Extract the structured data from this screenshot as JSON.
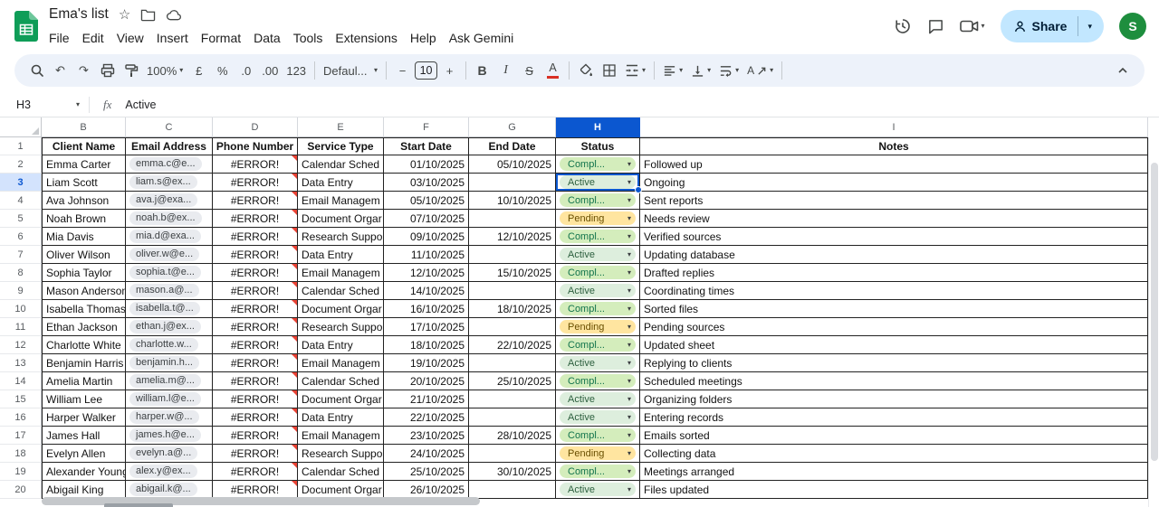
{
  "topbar": {
    "title": "Ema's list",
    "menus": [
      "File",
      "Edit",
      "View",
      "Insert",
      "Format",
      "Data",
      "Tools",
      "Extensions",
      "Help",
      "Ask Gemini"
    ],
    "share_label": "Share",
    "avatar_letter": "S"
  },
  "icons": {
    "star": "☆",
    "undo": "↶",
    "redo": "↷",
    "currency": "£",
    "percent": "%",
    "decrease_decimal": ".0",
    "increase_decimal": ".00",
    "number_format": "123",
    "minus": "−",
    "plus": "+",
    "bold": "B",
    "italic": "I",
    "strikethrough": "S",
    "text_color_letter": "A",
    "rotate_letter": "A",
    "more_vert": "⋮",
    "caret_down": "▾"
  },
  "toolbar": {
    "zoom": "100%",
    "font_name": "Defaul...",
    "font_size": "10"
  },
  "formula_bar": {
    "cell_ref": "H3",
    "fx_label": "fx",
    "value": "Active"
  },
  "grid": {
    "column_letters": [
      "B",
      "C",
      "D",
      "E",
      "F",
      "G",
      "H",
      "I"
    ],
    "selected_column": "H",
    "selected_row": 3,
    "selected_cell": "H3",
    "header_row": [
      "Client Name",
      "Email Address",
      "Phone Number",
      "Service Type",
      "Start Date",
      "End Date",
      "Status",
      "Notes"
    ],
    "rows": [
      {
        "n": 2,
        "client": "Emma Carter",
        "email": "emma.c@e...",
        "phone": "#ERROR!",
        "service": "Calendar Sched",
        "start": "01/10/2025",
        "end": "05/10/2025",
        "status": "Compl...",
        "status_type": "completed",
        "notes": "Followed up"
      },
      {
        "n": 3,
        "client": "Liam Scott",
        "email": "liam.s@ex...",
        "phone": "#ERROR!",
        "service": "Data Entry",
        "start": "03/10/2025",
        "end": "",
        "status": "Active",
        "status_type": "active",
        "notes": "Ongoing"
      },
      {
        "n": 4,
        "client": "Ava Johnson",
        "email": "ava.j@exa...",
        "phone": "#ERROR!",
        "service": "Email Managem",
        "start": "05/10/2025",
        "end": "10/10/2025",
        "status": "Compl...",
        "status_type": "completed",
        "notes": "Sent reports"
      },
      {
        "n": 5,
        "client": "Noah Brown",
        "email": "noah.b@ex...",
        "phone": "#ERROR!",
        "service": "Document Orgar",
        "start": "07/10/2025",
        "end": "",
        "status": "Pending",
        "status_type": "pending",
        "notes": "Needs review"
      },
      {
        "n": 6,
        "client": "Mia Davis",
        "email": "mia.d@exa...",
        "phone": "#ERROR!",
        "service": "Research Suppo",
        "start": "09/10/2025",
        "end": "12/10/2025",
        "status": "Compl...",
        "status_type": "completed",
        "notes": "Verified sources"
      },
      {
        "n": 7,
        "client": "Oliver Wilson",
        "email": "oliver.w@e...",
        "phone": "#ERROR!",
        "service": "Data Entry",
        "start": "11/10/2025",
        "end": "",
        "status": "Active",
        "status_type": "active",
        "notes": "Updating database"
      },
      {
        "n": 8,
        "client": "Sophia Taylor",
        "email": "sophia.t@e...",
        "phone": "#ERROR!",
        "service": "Email Managem",
        "start": "12/10/2025",
        "end": "15/10/2025",
        "status": "Compl...",
        "status_type": "completed",
        "notes": "Drafted replies"
      },
      {
        "n": 9,
        "client": "Mason Anderson",
        "email": "mason.a@...",
        "phone": "#ERROR!",
        "service": "Calendar Sched",
        "start": "14/10/2025",
        "end": "",
        "status": "Active",
        "status_type": "active",
        "notes": "Coordinating times"
      },
      {
        "n": 10,
        "client": "Isabella Thomas",
        "email": "isabella.t@...",
        "phone": "#ERROR!",
        "service": "Document Orgar",
        "start": "16/10/2025",
        "end": "18/10/2025",
        "status": "Compl...",
        "status_type": "completed",
        "notes": "Sorted files"
      },
      {
        "n": 11,
        "client": "Ethan Jackson",
        "email": "ethan.j@ex...",
        "phone": "#ERROR!",
        "service": "Research Suppo",
        "start": "17/10/2025",
        "end": "",
        "status": "Pending",
        "status_type": "pending",
        "notes": "Pending sources"
      },
      {
        "n": 12,
        "client": "Charlotte White",
        "email": "charlotte.w...",
        "phone": "#ERROR!",
        "service": "Data Entry",
        "start": "18/10/2025",
        "end": "22/10/2025",
        "status": "Compl...",
        "status_type": "completed",
        "notes": "Updated sheet"
      },
      {
        "n": 13,
        "client": "Benjamin Harris",
        "email": "benjamin.h...",
        "phone": "#ERROR!",
        "service": "Email Managem",
        "start": "19/10/2025",
        "end": "",
        "status": "Active",
        "status_type": "active",
        "notes": "Replying to clients"
      },
      {
        "n": 14,
        "client": "Amelia Martin",
        "email": "amelia.m@...",
        "phone": "#ERROR!",
        "service": "Calendar Sched",
        "start": "20/10/2025",
        "end": "25/10/2025",
        "status": "Compl...",
        "status_type": "completed",
        "notes": "Scheduled meetings"
      },
      {
        "n": 15,
        "client": "William Lee",
        "email": "william.l@e...",
        "phone": "#ERROR!",
        "service": "Document Orgar",
        "start": "21/10/2025",
        "end": "",
        "status": "Active",
        "status_type": "active",
        "notes": "Organizing folders"
      },
      {
        "n": 16,
        "client": "Harper Walker",
        "email": "harper.w@...",
        "phone": "#ERROR!",
        "service": "Data Entry",
        "start": "22/10/2025",
        "end": "",
        "status": "Active",
        "status_type": "active",
        "notes": "Entering records"
      },
      {
        "n": 17,
        "client": "James Hall",
        "email": "james.h@e...",
        "phone": "#ERROR!",
        "service": "Email Managem",
        "start": "23/10/2025",
        "end": "28/10/2025",
        "status": "Compl...",
        "status_type": "completed",
        "notes": "Emails sorted"
      },
      {
        "n": 18,
        "client": "Evelyn Allen",
        "email": "evelyn.a@...",
        "phone": "#ERROR!",
        "service": "Research Suppo",
        "start": "24/10/2025",
        "end": "",
        "status": "Pending",
        "status_type": "pending",
        "notes": "Collecting data"
      },
      {
        "n": 19,
        "client": "Alexander Young",
        "email": "alex.y@ex...",
        "phone": "#ERROR!",
        "service": "Calendar Sched",
        "start": "25/10/2025",
        "end": "30/10/2025",
        "status": "Compl...",
        "status_type": "completed",
        "notes": "Meetings arranged"
      },
      {
        "n": 20,
        "client": "Abigail King",
        "email": "abigail.k@...",
        "phone": "#ERROR!",
        "service": "Document Orgar",
        "start": "26/10/2025",
        "end": "",
        "status": "Active",
        "status_type": "active",
        "notes": "Files updated"
      }
    ]
  },
  "colors": {
    "accent_blue": "#0b57d0",
    "share_bg": "#c2e7ff",
    "logo_green": "#0f9d58",
    "chip_completed": "#d4edbc",
    "chip_pending": "#ffe5a0",
    "chip_active": "#ddeedd",
    "error_flag": "#ea4335"
  }
}
